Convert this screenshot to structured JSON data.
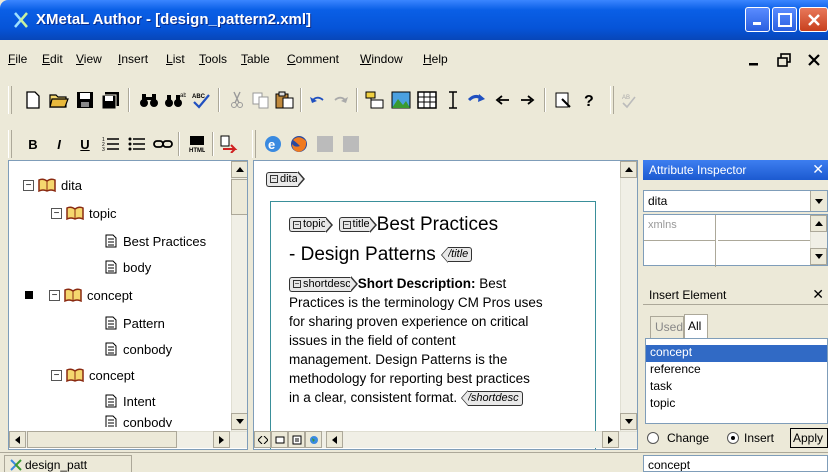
{
  "window": {
    "title": "XMetaL Author - [design_pattern2.xml]"
  },
  "menu": [
    "File",
    "Edit",
    "View",
    "Insert",
    "List",
    "Tools",
    "Table",
    "Comment",
    "Window",
    "Help"
  ],
  "toolbar2": {
    "bold": "B",
    "italic": "I",
    "underline": "U"
  },
  "tree": {
    "items": [
      {
        "label": "dita"
      },
      {
        "label": "topic"
      },
      {
        "label": "Best Practices"
      },
      {
        "label": "body"
      },
      {
        "label": "concept"
      },
      {
        "label": "Pattern"
      },
      {
        "label": "conbody"
      },
      {
        "label": "concept"
      },
      {
        "label": "Intent"
      },
      {
        "label": "conbody"
      }
    ]
  },
  "editor": {
    "root_tag": "dita",
    "topic_tag": "topic",
    "title_tag": "title",
    "title_text_1": "Best Practices",
    "title_text_2": "- Design Patterns",
    "title_close_tag": "/title",
    "shortdesc_tag": "shortdesc",
    "shortdesc_label": "Short Description:",
    "shortdesc_line1": " Best",
    "shortdesc_lines": [
      "Practices is the terminology CM Pros uses",
      "for sharing proven experience on critical",
      "issues in the field of content",
      "management. Design Patterns is the",
      "methodology for reporting best practices",
      "in a clear, consistent format."
    ],
    "shortdesc_close_tag": "/shortdesc"
  },
  "attribute_inspector": {
    "title": "Attribute Inspector",
    "element_value": "dita",
    "attr_name": "xmlns"
  },
  "insert_element": {
    "title": "Insert Element",
    "tab_used": "Used",
    "tab_all": "All",
    "items": [
      "concept",
      "reference",
      "task",
      "topic"
    ],
    "selected": "concept",
    "radio_change": "Change",
    "radio_insert": "Insert",
    "apply_label": "Apply",
    "value": "concept"
  },
  "status": {
    "doc_tab": "design_patt"
  },
  "colors": {
    "titlebar": "#0654d8",
    "selection": "#316ac5",
    "frame": "#3a8f9a"
  }
}
